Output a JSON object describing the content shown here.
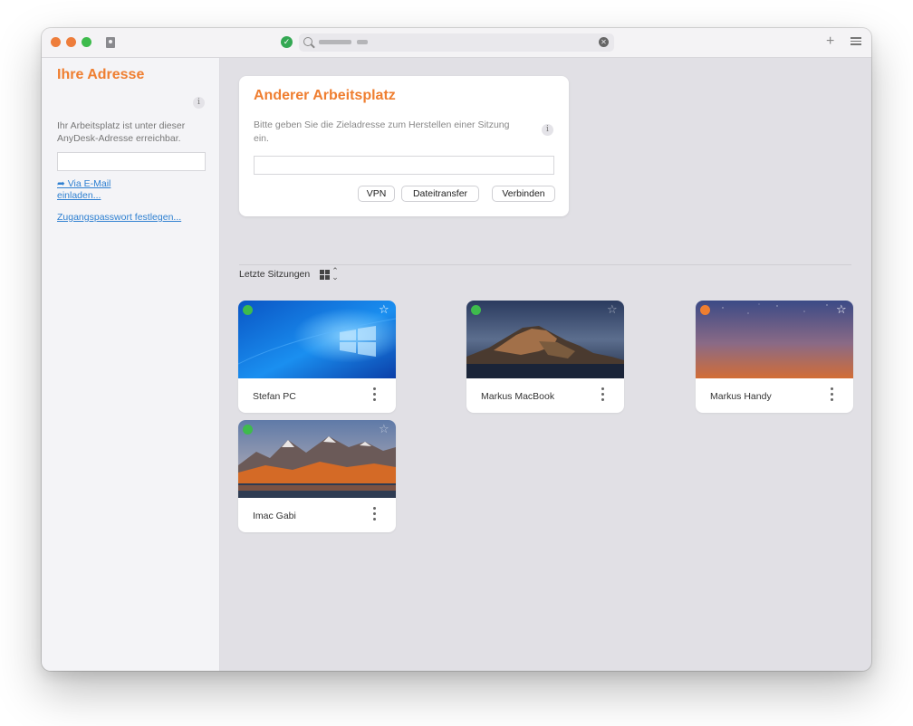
{
  "colors": {
    "accent": "#ef7e30",
    "link": "#2f80d1",
    "online": "#3ebb4c",
    "offline": "#ef7e30"
  },
  "titlebar": {
    "search_text": ""
  },
  "sidebar": {
    "title": "Ihre Adresse",
    "description": "Ihr Arbeitsplatz ist unter dieser AnyDesk-Adresse erreichbar.",
    "address_value": "",
    "invite_link": "➦ Via E-Mail einladen...",
    "password_link": "Zugangspasswort festlegen..."
  },
  "connect": {
    "title": "Anderer Arbeitsplatz",
    "description": "Bitte geben Sie die Zieladresse zum Herstellen einer Sitzung ein.",
    "input_value": "",
    "buttons": {
      "vpn": "VPN",
      "file_transfer": "Dateitransfer",
      "connect": "Verbinden"
    }
  },
  "recent": {
    "label": "Letzte Sitzungen",
    "sessions": [
      {
        "name": "Stefan PC",
        "status": "online",
        "favorite": true,
        "thumbnail": "windows-wallpaper"
      },
      {
        "name": "Markus MacBook",
        "status": "online",
        "favorite": false,
        "thumbnail": "macos-catalina-wallpaper"
      },
      {
        "name": "Markus Handy",
        "status": "offline",
        "favorite": true,
        "thumbnail": "dusk-gradient"
      },
      {
        "name": "Imac Gabi",
        "status": "online",
        "favorite": false,
        "thumbnail": "macos-high-sierra-wallpaper"
      }
    ]
  }
}
